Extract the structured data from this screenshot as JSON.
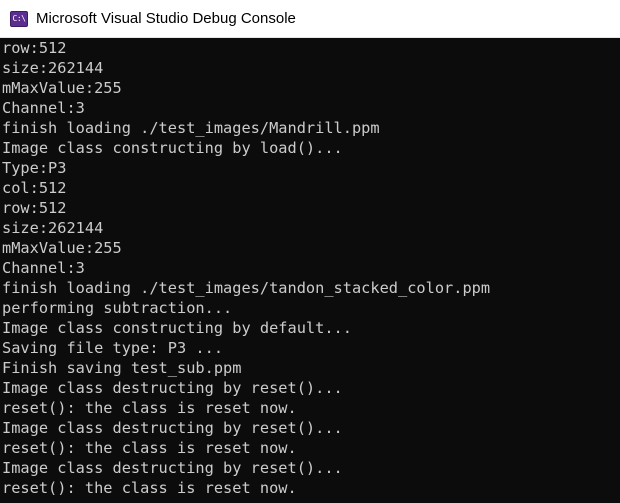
{
  "window": {
    "title": "Microsoft Visual Studio Debug Console",
    "icon": "vs-console-icon",
    "icon_glyph": "C:\\"
  },
  "colors": {
    "console_bg": "#0c0c0c",
    "console_text": "#cccccc",
    "titlebar_bg": "#ffffff",
    "icon_accent": "#5c2d91"
  },
  "console": {
    "lines": [
      "row:512",
      "size:262144",
      "mMaxValue:255",
      "Channel:3",
      "finish loading ./test_images/Mandrill.ppm",
      "Image class constructing by load()...",
      "Type:P3",
      "col:512",
      "row:512",
      "size:262144",
      "mMaxValue:255",
      "Channel:3",
      "finish loading ./test_images/tandon_stacked_color.ppm",
      "performing subtraction...",
      "Image class constructing by default...",
      "Saving file type: P3 ...",
      "Finish saving test_sub.ppm",
      "Image class destructing by reset()...",
      "reset(): the class is reset now.",
      "Image class destructing by reset()...",
      "reset(): the class is reset now.",
      "Image class destructing by reset()...",
      "reset(): the class is reset now."
    ]
  }
}
